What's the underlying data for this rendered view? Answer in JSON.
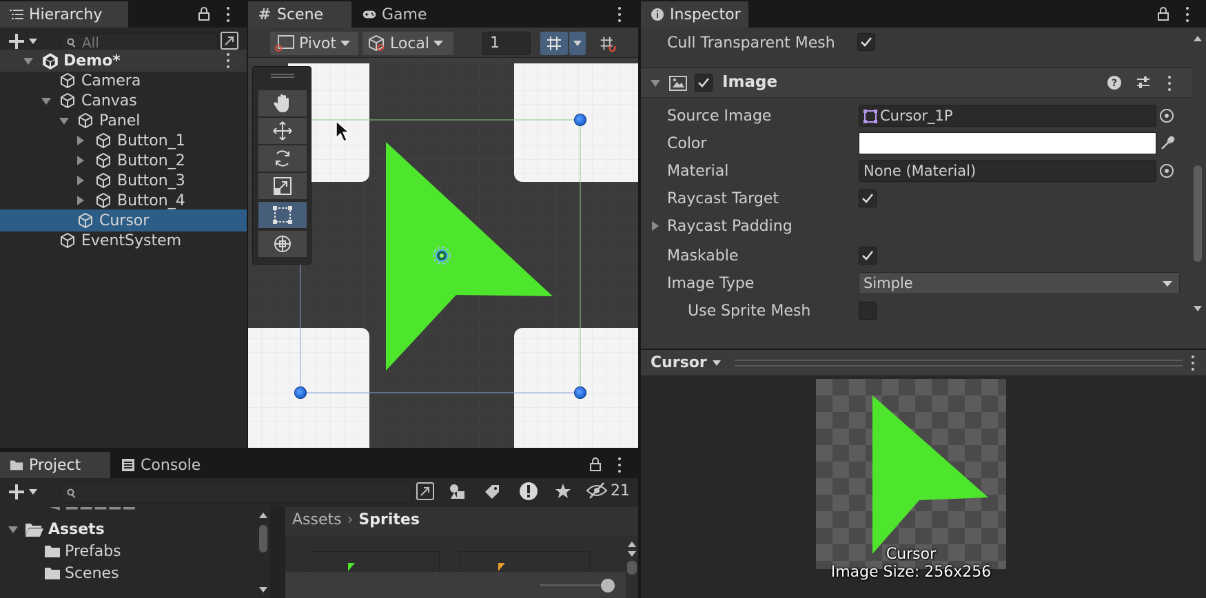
{
  "hierarchy": {
    "tab_label": "Hierarchy",
    "search_placeholder": "All",
    "items": [
      {
        "label": "Demo*",
        "level": 0,
        "expanded": true,
        "scene": true
      },
      {
        "label": "Camera",
        "level": 1
      },
      {
        "label": "Canvas",
        "level": 1,
        "expanded": true
      },
      {
        "label": "Panel",
        "level": 2,
        "expanded": true
      },
      {
        "label": "Button_1",
        "level": 3,
        "collapsed": true
      },
      {
        "label": "Button_2",
        "level": 3,
        "collapsed": true
      },
      {
        "label": "Button_3",
        "level": 3,
        "collapsed": true
      },
      {
        "label": "Button_4",
        "level": 3,
        "collapsed": true
      },
      {
        "label": "Cursor",
        "level": 2,
        "selected": true
      },
      {
        "label": "EventSystem",
        "level": 1
      }
    ]
  },
  "scene": {
    "tab_scene": "Scene",
    "tab_game": "Game",
    "pivot_label": "Pivot",
    "local_label": "Local",
    "grid_snap_value": "1",
    "tools": [
      "hand-tool",
      "move-tool",
      "rotate-tool",
      "scale-tool",
      "rect-tool",
      "transform-tool"
    ],
    "active_tool": "rect-tool"
  },
  "project": {
    "tab_project": "Project",
    "tab_console": "Console",
    "hidden_count": "21",
    "breadcrumb_root": "Assets",
    "breadcrumb_current": "Sprites",
    "folders": [
      {
        "label": "Assets",
        "root": true
      },
      {
        "label": "Prefabs"
      },
      {
        "label": "Scenes"
      }
    ]
  },
  "inspector": {
    "tab_label": "Inspector",
    "cull_label": "Cull Transparent Mesh",
    "component_title": "Image",
    "rows": {
      "source_image_label": "Source Image",
      "source_image_value": "Cursor_1P",
      "color_label": "Color",
      "material_label": "Material",
      "material_value": "None (Material)",
      "raycast_target_label": "Raycast Target",
      "raycast_padding_label": "Raycast Padding",
      "maskable_label": "Maskable",
      "image_type_label": "Image Type",
      "image_type_value": "Simple",
      "use_sprite_mesh_label": "Use Sprite Mesh"
    }
  },
  "preview": {
    "title": "Cursor",
    "caption_name": "Cursor",
    "caption_size": "Image Size: 256x256"
  },
  "colors": {
    "selection": "#2c5d87",
    "sprite_green": "#4ee62c",
    "handle_blue": "#2a7ae8"
  }
}
